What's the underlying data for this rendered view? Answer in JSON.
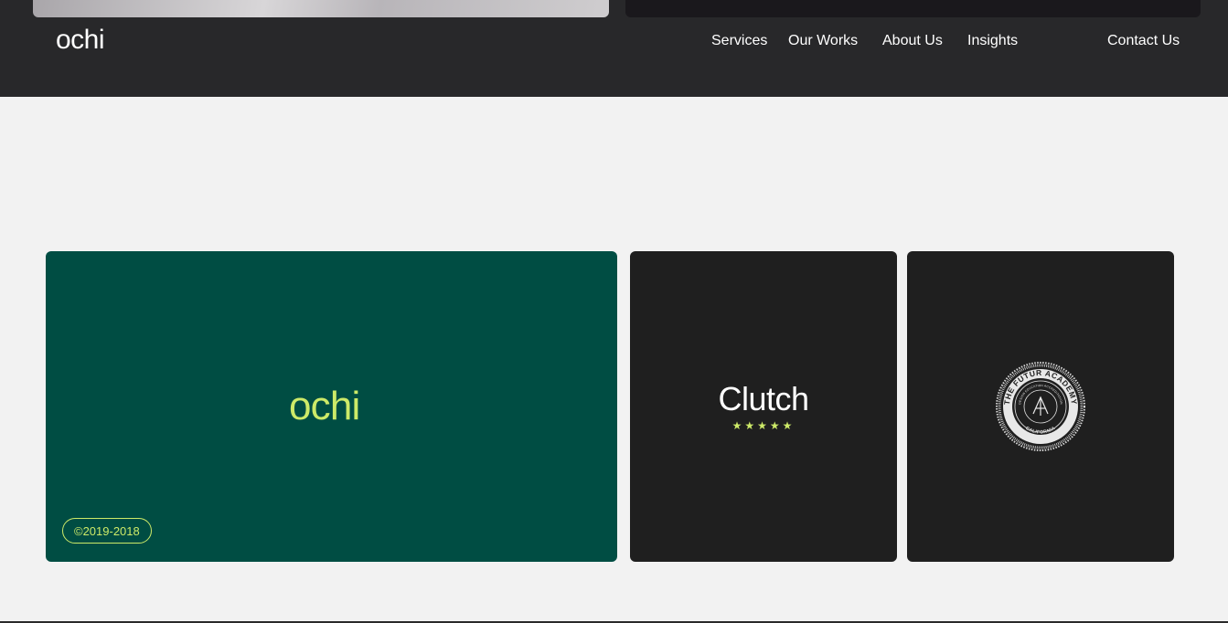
{
  "header": {
    "logo": "ochi",
    "nav": {
      "services": "Services",
      "our_works": "Our Works",
      "about_us": "About Us",
      "insights": "Insights",
      "contact_us": "Contact Us"
    }
  },
  "cards": {
    "main": {
      "logo": "ochi",
      "copyright": "©2019-2018"
    },
    "clutch": {
      "title": "Clutch",
      "stars": "★★★★★"
    },
    "academy": {
      "outer_text": "THE FUTUR ACADEMY",
      "inner_text": "DESIGN EDUCATION ACCREDITATION",
      "bottom_text": "CALIFORNIA",
      "icon": "academy-seal-icon"
    }
  },
  "colors": {
    "header_bg": "#28282a",
    "page_bg": "#f2f2f2",
    "green_card": "#004d43",
    "accent": "#cdea68",
    "dark_card": "#1f1f1f"
  }
}
